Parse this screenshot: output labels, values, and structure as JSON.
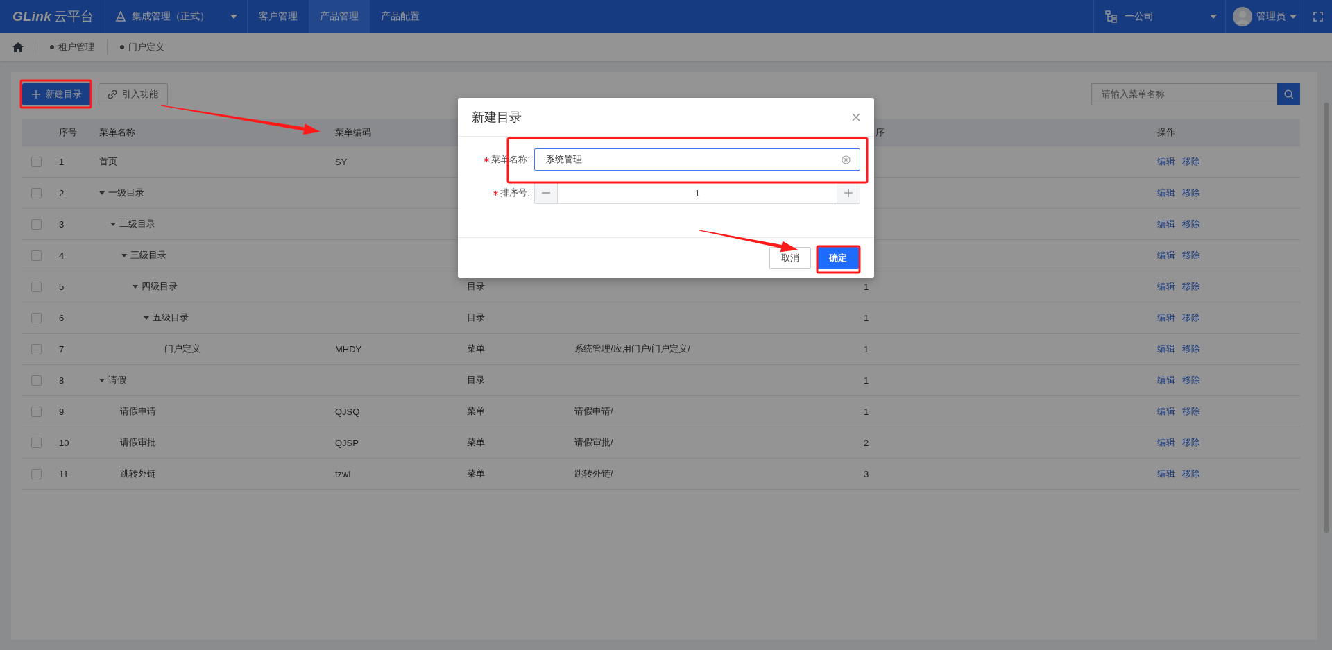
{
  "topbar": {
    "logo": {
      "brand": "GLink",
      "product": "云平台"
    },
    "system": {
      "label": "集成管理（正式）"
    },
    "tabs": [
      {
        "label": "客户管理",
        "selected": false
      },
      {
        "label": "产品管理",
        "selected": true
      },
      {
        "label": "产品配置",
        "selected": false
      }
    ],
    "company": "一公司",
    "user": "管理员"
  },
  "breadcrumb": [
    {
      "label": "租户管理"
    },
    {
      "label": "门户定义"
    }
  ],
  "toolbar": {
    "buttons": [
      {
        "label": "新建目录",
        "kind": "primary"
      },
      {
        "label": "引入功能",
        "kind": "link"
      }
    ],
    "search": {
      "placeholder": "请输入菜单名称"
    }
  },
  "table": {
    "header": {
      "number": "序号",
      "name": "菜单名称",
      "code": "菜单编码",
      "sort": "序",
      "actions": "操作"
    },
    "rows": [
      {
        "number": "1",
        "name": "首页",
        "code": "SY",
        "checked": false,
        "actions": [
          "编辑",
          "移除"
        ]
      },
      {
        "number": "2",
        "name": "一级目录",
        "checked": false,
        "expanded": true,
        "actions": [
          "编辑",
          "移除"
        ],
        "children": [
          {
            "number": "3",
            "name": "二级目录",
            "checked": false,
            "expanded": true,
            "actions": [
              "编辑",
              "移除"
            ],
            "children": [
              {
                "number": "4",
                "name": "三级目录",
                "checked": false,
                "expanded": true,
                "actions": [
                  "编辑",
                  "移除"
                ],
                "children": [
                  {
                    "number": "5",
                    "name": "四级目录",
                    "type": "目录",
                    "sort": "1",
                    "checked": false,
                    "expanded": true,
                    "actions": [
                      "编辑",
                      "移除"
                    ],
                    "children": [
                      {
                        "number": "6",
                        "name": "五级目录",
                        "type": "目录",
                        "sort": "1",
                        "checked": false,
                        "expanded": true,
                        "actions": [
                          "编辑",
                          "移除"
                        ],
                        "children": [
                          {
                            "number": "7",
                            "name": "门户定义",
                            "code": "MHDY",
                            "type": "菜单",
                            "path": "系统管理/应用门户/门户定义/",
                            "sort": "1",
                            "checked": false,
                            "actions": [
                              "编辑",
                              "移除"
                            ]
                          }
                        ]
                      }
                    ]
                  }
                ]
              }
            ]
          }
        ]
      },
      {
        "number": "8",
        "name": "请假",
        "type": "目录",
        "sort": "1",
        "checked": false,
        "expanded": true,
        "actions": [
          "编辑",
          "移除"
        ],
        "children": [
          {
            "number": "9",
            "name": "请假申请",
            "code": "QJSQ",
            "type": "菜单",
            "path": "请假申请/",
            "sort": "1",
            "checked": false,
            "actions": [
              "编辑",
              "移除"
            ]
          },
          {
            "number": "10",
            "name": "请假审批",
            "code": "QJSP",
            "type": "菜单",
            "path": "请假审批/",
            "sort": "2",
            "checked": false,
            "actions": [
              "编辑",
              "移除"
            ]
          },
          {
            "number": "11",
            "name": "跳转外链",
            "code": "tzwl",
            "type": "菜单",
            "path": "跳转外链/",
            "sort": "3",
            "checked": false,
            "actions": [
              "编辑",
              "移除"
            ]
          }
        ]
      }
    ]
  },
  "dialog": {
    "title": "新建目录",
    "fields": [
      {
        "label": "菜单名称:",
        "required": true,
        "kind": "text",
        "value": "系统管理"
      },
      {
        "label": "排序号:",
        "required": true,
        "kind": "number",
        "value": "1"
      }
    ],
    "buttons": [
      {
        "label": "取消",
        "kind": "default"
      },
      {
        "label": "确定",
        "kind": "primary"
      }
    ]
  }
}
